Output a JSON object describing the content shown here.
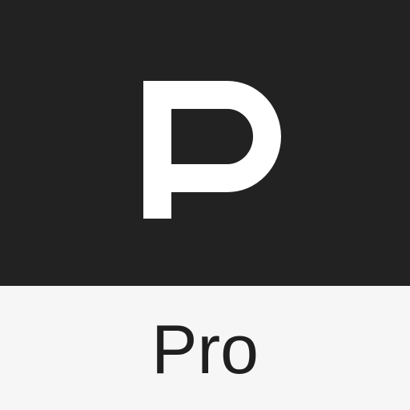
{
  "icon": {
    "logo_letter": "P",
    "edition_label": "Pro",
    "logo_icon": "letter-p-logo-icon"
  },
  "colors": {
    "top_background": "#222222",
    "bottom_background": "#f6f6f6",
    "logo_fill": "#ffffff",
    "label_color": "#1f1f1f"
  }
}
